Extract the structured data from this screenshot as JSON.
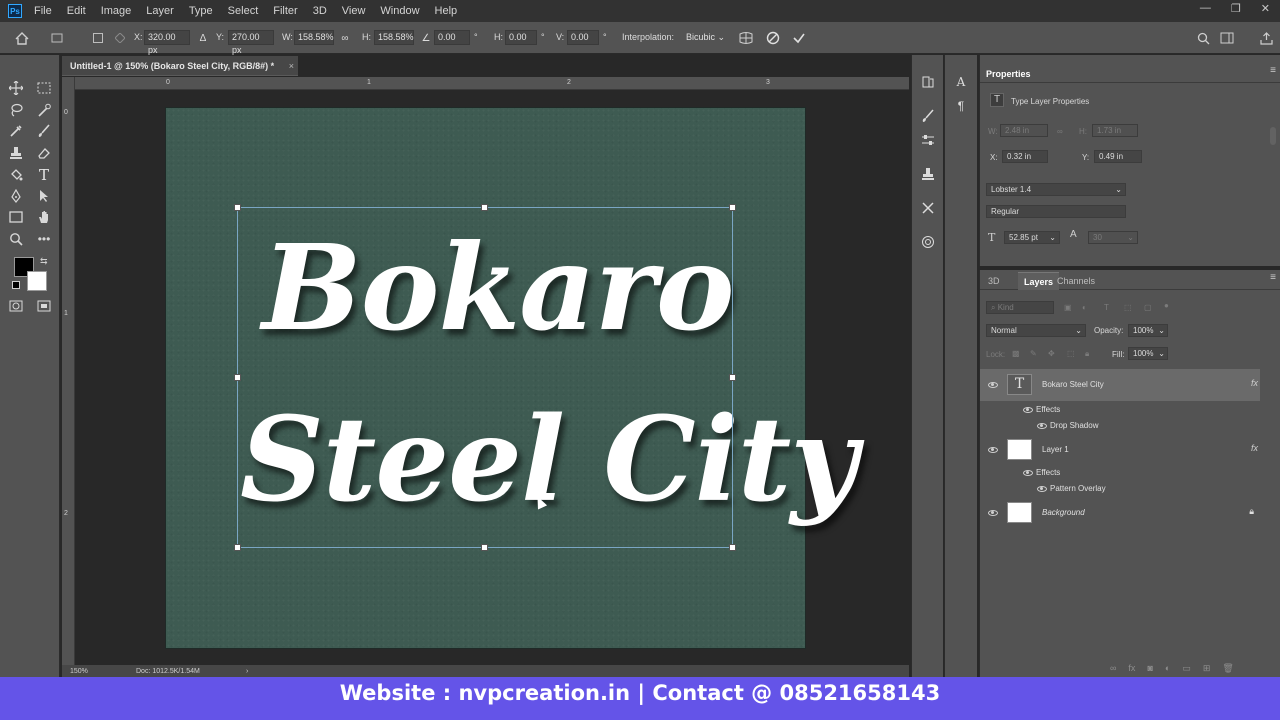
{
  "menubar": {
    "items": [
      "File",
      "Edit",
      "Image",
      "Layer",
      "Type",
      "Select",
      "Filter",
      "3D",
      "View",
      "Window",
      "Help"
    ]
  },
  "options": {
    "x_label": "X:",
    "x_value": "320.00 px",
    "y_label": "Y:",
    "y_value": "270.00 px",
    "w_label": "W:",
    "w_value": "158.58%",
    "h_label": "H:",
    "h_value": "158.58%",
    "angle_value": "0.00",
    "hskew_label": "H:",
    "hskew_value": "0.00",
    "vskew_label": "V:",
    "vskew_value": "0.00",
    "interpolation_label": "Interpolation:",
    "interpolation_value": "Bicubic"
  },
  "document": {
    "tab_title": "Untitled-1 @ 150% (Bokaro  Steel City, RGB/8#) *",
    "tab_close": "×",
    "canvas_line1": "Bokaro",
    "canvas_line2": "Steel City",
    "ruler_top": [
      "0",
      "1",
      "2",
      "3"
    ],
    "ruler_left": [
      "0",
      "1",
      "2"
    ],
    "zoom": "150%",
    "doc_info": "Doc: 1012.5K/1.54M"
  },
  "properties": {
    "tab": "Properties",
    "subtitle": "Type Layer Properties",
    "w_label": "W:",
    "w_value": "2.48 in",
    "h_label": "H:",
    "h_value": "1.73 in",
    "x_label": "X:",
    "x_value": "0.32 in",
    "y_label": "Y:",
    "y_value": "0.49 in",
    "font_family": "Lobster 1.4",
    "font_style": "Regular",
    "font_size": "52.85 pt",
    "leading": "30"
  },
  "layers": {
    "tabs": [
      "3D",
      "Layers",
      "Channels"
    ],
    "search_placeholder": "Kind",
    "blend_mode": "Normal",
    "opacity_label": "Opacity:",
    "opacity_value": "100%",
    "lock_label": "Lock:",
    "fill_label": "Fill:",
    "fill_value": "100%",
    "fx": "fx",
    "items": [
      {
        "name": "Bokaro  Steel City",
        "effects_label": "Effects",
        "effect": "Drop Shadow"
      },
      {
        "name": "Layer 1",
        "effects_label": "Effects",
        "effect": "Pattern Overlay"
      },
      {
        "name": "Background"
      }
    ]
  },
  "banner": {
    "text": "Website : nvpcreation.in | Contact @ 08521658143"
  },
  "colors": {
    "canvas": "#3e5b52",
    "banner": "#6454e8",
    "panel": "#535353",
    "accent": "#31a8ff"
  }
}
